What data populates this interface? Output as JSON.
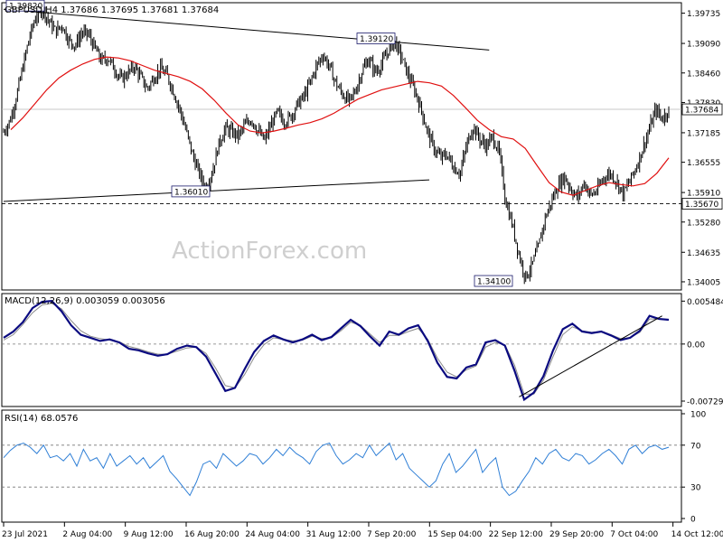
{
  "chart_data": [
    {
      "type": "candlestick",
      "title": "GBPUSD,H4  1.37686 1.37695 1.37681 1.37684",
      "watermark": "ActionForex.com",
      "y_axis_ticks": [
        "1.39735",
        "1.39090",
        "1.38460",
        "1.37830",
        "1.37185",
        "1.36555",
        "1.35910",
        "1.35280",
        "1.34635",
        "1.34005"
      ],
      "ylim": [
        1.3385,
        1.3992
      ],
      "last_price_label": "1.37684",
      "last_price": 1.37684,
      "support_label": "1.35670",
      "support_level": 1.3567,
      "level_labels": [
        {
          "text": "1.39820",
          "value": 1.3982
        },
        {
          "text": "1.39120",
          "value": 1.3912
        },
        {
          "text": "1.36010",
          "value": 1.3601
        },
        {
          "text": "1.34100",
          "value": 1.341
        }
      ],
      "x_ticks": [
        "23 Jul 2021",
        "2 Aug 04:00",
        "9 Aug 12:00",
        "16 Aug 20:00",
        "24 Aug 04:00",
        "31 Aug 12:00",
        "7 Sep 20:00",
        "15 Sep 04:00",
        "22 Sep 12:00",
        "29 Sep 20:00",
        "7 Oct 04:00",
        "14 Oct 12:00"
      ],
      "close_path": [
        1.372,
        1.3745,
        1.3798,
        1.3862,
        1.3925,
        1.3968,
        1.3982,
        1.3955,
        1.3935,
        1.3948,
        1.3915,
        1.3905,
        1.3932,
        1.3928,
        1.3898,
        1.3872,
        1.3878,
        1.3855,
        1.3832,
        1.3845,
        1.386,
        1.3838,
        1.3812,
        1.3835,
        1.3855,
        1.3842,
        1.3808,
        1.3768,
        1.3722,
        1.367,
        1.3632,
        1.3601,
        1.3635,
        1.3695,
        1.3728,
        1.372,
        1.3712,
        1.3735,
        1.3748,
        1.3722,
        1.3702,
        1.3735,
        1.3762,
        1.3742,
        1.3752,
        1.3778,
        1.3795,
        1.3825,
        1.3862,
        1.3885,
        1.3858,
        1.3822,
        1.38,
        1.3785,
        1.381,
        1.3852,
        1.3875,
        1.3848,
        1.3865,
        1.3895,
        1.3912,
        1.388,
        1.3842,
        1.381,
        1.377,
        1.372,
        1.3685,
        1.3665,
        1.3672,
        1.3645,
        1.3632,
        1.3692,
        1.3732,
        1.3705,
        1.369,
        1.371,
        1.3675,
        1.3572,
        1.3522,
        1.346,
        1.341,
        1.3435,
        1.3475,
        1.3535,
        1.3572,
        1.3605,
        1.3625,
        1.3598,
        1.358,
        1.3612,
        1.3585,
        1.3595,
        1.3622,
        1.3632,
        1.3615,
        1.3588,
        1.3615,
        1.3645,
        1.3685,
        1.3725,
        1.3768,
        1.3748,
        1.3768
      ],
      "ma_path": [
        1.3725,
        1.375,
        1.378,
        1.381,
        1.3835,
        1.3852,
        1.3865,
        1.3875,
        1.388,
        1.3878,
        1.3872,
        1.3862,
        1.3852,
        1.3845,
        1.3838,
        1.3828,
        1.3812,
        1.3788,
        1.376,
        1.3735,
        1.3722,
        1.3718,
        1.3722,
        1.3728,
        1.3735,
        1.374,
        1.3748,
        1.376,
        1.3775,
        1.379,
        1.38,
        1.381,
        1.3816,
        1.3822,
        1.3828,
        1.3825,
        1.3818,
        1.3798,
        1.3772,
        1.3745,
        1.3725,
        1.371,
        1.3705,
        1.3685,
        1.3648,
        1.3612,
        1.3592,
        1.3585,
        1.3595,
        1.3605,
        1.3612,
        1.3608,
        1.3605,
        1.361,
        1.3632,
        1.3665
      ],
      "trendlines": [
        {
          "from": [
            0,
            1.3982
          ],
          "to": [
            0.73,
            1.3895
          ]
        },
        {
          "from": [
            0,
            1.3572
          ],
          "to": [
            0.64,
            1.3618
          ]
        }
      ]
    },
    {
      "type": "line",
      "title": "MACD(12,26,9) 0.003059 0.003056",
      "y_axis_ticks": [
        "0.005484",
        "0.00",
        "-0.00729"
      ],
      "ylim": [
        -0.00775,
        0.0061
      ],
      "macd_path": [
        0.0008,
        0.0016,
        0.0028,
        0.0046,
        0.0054,
        0.0055,
        0.0042,
        0.0024,
        0.0012,
        0.0008,
        0.0004,
        0.0006,
        0.0002,
        -0.0006,
        -0.0008,
        -0.0012,
        -0.0015,
        -0.0013,
        -0.0006,
        -0.0002,
        -0.0004,
        -0.0016,
        -0.0038,
        -0.006,
        -0.0056,
        -0.0032,
        -0.001,
        0.0004,
        0.0011,
        0.0006,
        0.0002,
        0.0006,
        0.0012,
        0.0005,
        0.0009,
        0.002,
        0.0031,
        0.0023,
        0.001,
        -0.0002,
        0.0016,
        0.0012,
        0.002,
        0.0024,
        0.0004,
        -0.0024,
        -0.0042,
        -0.0044,
        -0.003,
        -0.0026,
        0.0002,
        0.0005,
        -0.0002,
        -0.0034,
        -0.0071,
        -0.0062,
        -0.0041,
        -0.0008,
        0.0019,
        0.0026,
        0.0016,
        0.0014,
        0.0016,
        0.0011,
        0.0005,
        0.0008,
        0.0017,
        0.0036,
        0.0032,
        0.0031
      ],
      "signal_path": [
        0.0005,
        0.0012,
        0.0025,
        0.004,
        0.005,
        0.0052,
        0.0045,
        0.003,
        0.0017,
        0.001,
        0.0007,
        0.0005,
        0.0003,
        -0.0003,
        -0.0006,
        -0.001,
        -0.0013,
        -0.0013,
        -0.0009,
        -0.0005,
        -0.0004,
        -0.0012,
        -0.0031,
        -0.0053,
        -0.0056,
        -0.0039,
        -0.0017,
        -0.0001,
        0.0008,
        0.0006,
        0.0004,
        0.0005,
        0.001,
        0.0007,
        0.0008,
        0.0017,
        0.0028,
        0.0024,
        0.0013,
        0.0002,
        0.0011,
        0.0011,
        0.0016,
        0.002,
        0.0006,
        -0.0018,
        -0.0036,
        -0.0042,
        -0.0033,
        -0.0028,
        -0.0004,
        0.0002,
        -0.0001,
        -0.0027,
        -0.0064,
        -0.0064,
        -0.0046,
        -0.0016,
        0.0012,
        0.0022,
        0.0017,
        0.0015,
        0.0016,
        0.0012,
        0.0007,
        0.0008,
        0.0015,
        0.0032,
        0.0032,
        0.0031
      ],
      "trendline": {
        "from": [
          0.775,
          -0.00675
        ],
        "to": [
          0.99,
          0.0036
        ]
      }
    },
    {
      "type": "line",
      "title": "RSI(14) 68.0576",
      "y_axis_ticks": [
        "100",
        "70",
        "30",
        "0"
      ],
      "levels": [
        70,
        30
      ],
      "ylim": [
        0,
        100
      ],
      "rsi_path": [
        58,
        65,
        70,
        72,
        68,
        62,
        70,
        58,
        60,
        55,
        62,
        50,
        66,
        55,
        58,
        48,
        62,
        50,
        55,
        60,
        52,
        58,
        48,
        54,
        60,
        45,
        38,
        30,
        22,
        35,
        52,
        55,
        48,
        62,
        56,
        50,
        55,
        62,
        60,
        52,
        58,
        66,
        60,
        68,
        62,
        58,
        52,
        64,
        70,
        72,
        60,
        52,
        56,
        62,
        58,
        70,
        60,
        66,
        72,
        56,
        62,
        48,
        42,
        36,
        30,
        36,
        52,
        62,
        44,
        50,
        58,
        66,
        44,
        52,
        58,
        30,
        22,
        26,
        36,
        45,
        58,
        52,
        62,
        66,
        58,
        55,
        62,
        60,
        52,
        56,
        62,
        66,
        60,
        52,
        66,
        70,
        62,
        68,
        70,
        66,
        68
      ]
    }
  ]
}
